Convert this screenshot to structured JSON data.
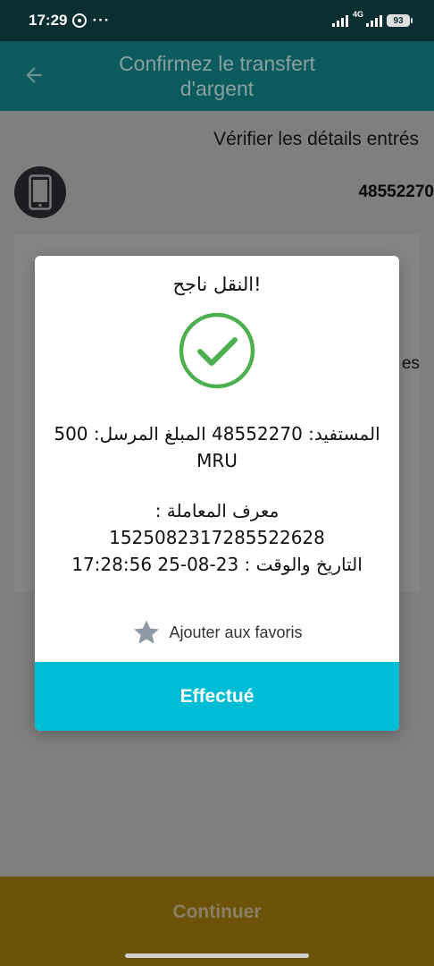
{
  "status_bar": {
    "time": "17:29",
    "dots": "···",
    "network": "4G",
    "battery": "93"
  },
  "header": {
    "title": "Confirmez le transfert d'argent"
  },
  "content": {
    "verify_label": "Vérifier les détails entrés",
    "phone_number": "48552270",
    "fragment": "es"
  },
  "dialog": {
    "title": "النقل ناجح!",
    "beneficiary_line": "المستفيد: 48552270 المبلغ المرسل: 500",
    "currency_line": "MRU",
    "txn_label_line": "معرف المعاملة :",
    "txn_id_line": "1525082317285522628",
    "datetime_line": "التاريخ والوقت : 23-08-25 17:28:56",
    "favorite_label": "Ajouter aux favoris",
    "done_label": "Effectué"
  },
  "footer": {
    "continue_label": "Continuer"
  },
  "colors": {
    "status_bar": "#0b2e30",
    "header_dimmed": "#0b5a5e",
    "success_green": "#4caf50",
    "primary_button": "#00bcd4",
    "continue_dimmed": "#6b5208"
  }
}
